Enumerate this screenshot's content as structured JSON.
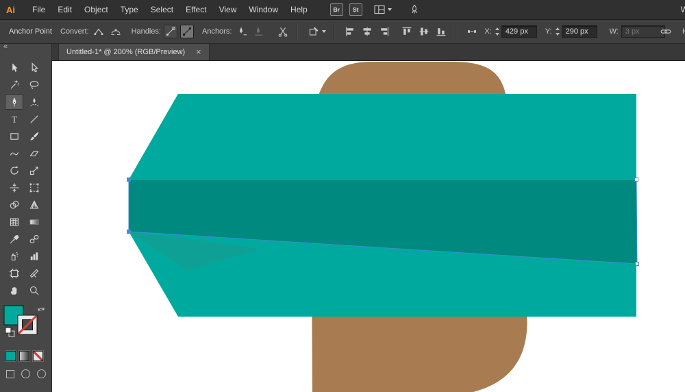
{
  "colors": {
    "teal-light": "#00A99D",
    "teal-dark": "#00897F",
    "teal-mid": "#0FA095",
    "brown": "#A87C50",
    "selection": "#3E8ED2"
  },
  "menubar": {
    "logo": "Ai",
    "items": [
      "File",
      "Edit",
      "Object",
      "Type",
      "Select",
      "Effect",
      "View",
      "Window",
      "Help"
    ],
    "bridge_badge": "Br",
    "stock_badge": "St",
    "icons": [
      "workspace-switcher-icon",
      "chevron-down-icon",
      "gpu-performance-icon"
    ],
    "right_edge_text": "W"
  },
  "controlbar": {
    "context_label": "Anchor Point",
    "convert_label": "Convert:",
    "handles_label": "Handles:",
    "anchors_label": "Anchors:",
    "x_label": "X:",
    "x_value": "429 px",
    "y_label": "Y:",
    "y_value": "290 px",
    "w_label": "W:",
    "w_value": "3 px",
    "h_label": "H",
    "icons": [
      "convert-to-corner-icon",
      "convert-to-smooth-icon",
      "handles-hide-icon",
      "handles-show-icon",
      "remove-anchor-icon",
      "connect-anchors-icon",
      "cut-path-icon",
      "isolate-object-icon",
      "align-left-icon",
      "align-center-icon",
      "align-right-icon",
      "align-top-icon",
      "align-middle-icon",
      "align-bottom-icon",
      "reference-point-icon",
      "link-dimensions-icon"
    ]
  },
  "tabbar": {
    "tab_title": "Untitled-1* @ 200% (RGB/Preview)",
    "close_glyph": "×"
  },
  "toolbar": {
    "collapse_glyph": "«",
    "type_glyph": "T",
    "active_tool": "pen-tool",
    "tools": [
      "selection-tool",
      "direct-selection-tool",
      "magic-wand-tool",
      "lasso-tool",
      "pen-tool",
      "curvature-tool",
      "type-tool",
      "line-segment-tool",
      "rectangle-tool",
      "paintbrush-tool",
      "shaper-tool",
      "eraser-tool",
      "rotate-tool",
      "scale-tool",
      "width-tool",
      "free-transform-tool",
      "shape-builder-tool",
      "perspective-grid-tool",
      "mesh-tool",
      "gradient-tool",
      "eyedropper-tool",
      "blend-tool",
      "symbol-sprayer-tool",
      "column-graph-tool",
      "artboard-tool",
      "slice-tool",
      "hand-tool",
      "zoom-tool"
    ]
  },
  "canvas": {
    "shapes": [
      "brown-background-shape",
      "teal-banner-shape",
      "selected-path-segment",
      "fold-wedge-shape"
    ]
  }
}
